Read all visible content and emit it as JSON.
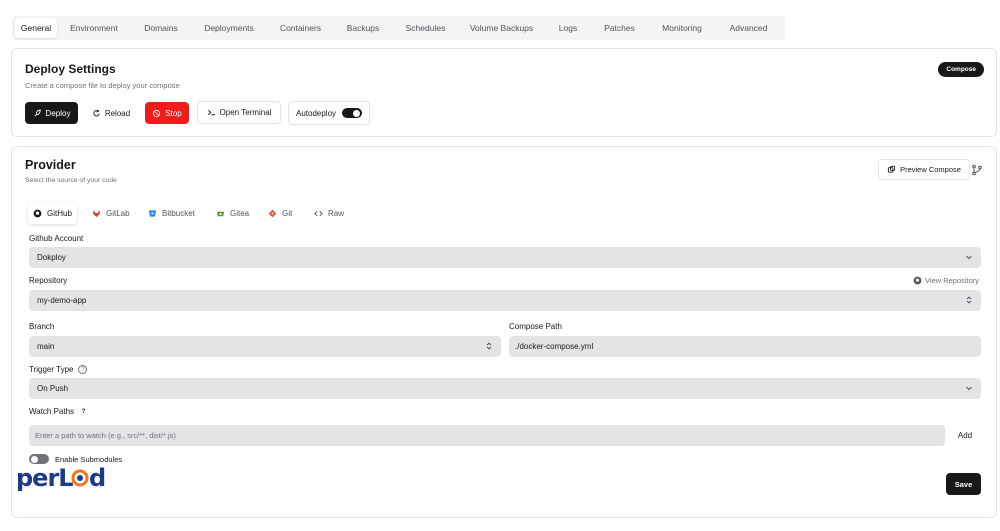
{
  "tabs": [
    "General",
    "Environment",
    "Domains",
    "Deployments",
    "Containers",
    "Backups",
    "Schedules",
    "Volume Backups",
    "Logs",
    "Patches",
    "Monitoring",
    "Advanced"
  ],
  "deploy": {
    "title": "Deploy Settings",
    "subtitle": "Create a compose file to deploy your compose",
    "badge": "Compose",
    "deploy_label": "Deploy",
    "reload_label": "Reload",
    "stop_label": "Stop",
    "terminal_label": "Open Terminal",
    "autodeploy_label": "Autodeploy",
    "autodeploy_on": true
  },
  "provider": {
    "title": "Provider",
    "subtitle": "Select the source of your code",
    "preview_label": "Preview Compose",
    "providers": [
      "GitHub",
      "GitLab",
      "Bitbucket",
      "Gitea",
      "Git",
      "Raw"
    ],
    "active_provider": "GitHub",
    "github_account_label": "Github Account",
    "github_account_value": "Dokploy",
    "repository_label": "Repository",
    "view_repository_label": "View Repository",
    "repository_value": "my-demo-app",
    "branch_label": "Branch",
    "branch_value": "main",
    "compose_path_label": "Compose Path",
    "compose_path_value": "./docker-compose.yml",
    "trigger_type_label": "Trigger Type",
    "trigger_type_value": "On Push",
    "watch_paths_label": "Watch Paths",
    "watch_paths_placeholder": "Enter a path to watch (e.g., src/**, dist/*.js)",
    "add_label": "Add",
    "submodules_label": "Enable Submodules",
    "submodules_on": false,
    "save_label": "Save"
  },
  "watermark": "perLod",
  "colors": {
    "primary": "#18181b",
    "danger": "#ef1c1c",
    "field": "#e4e4e7",
    "muted": "#71717a"
  }
}
